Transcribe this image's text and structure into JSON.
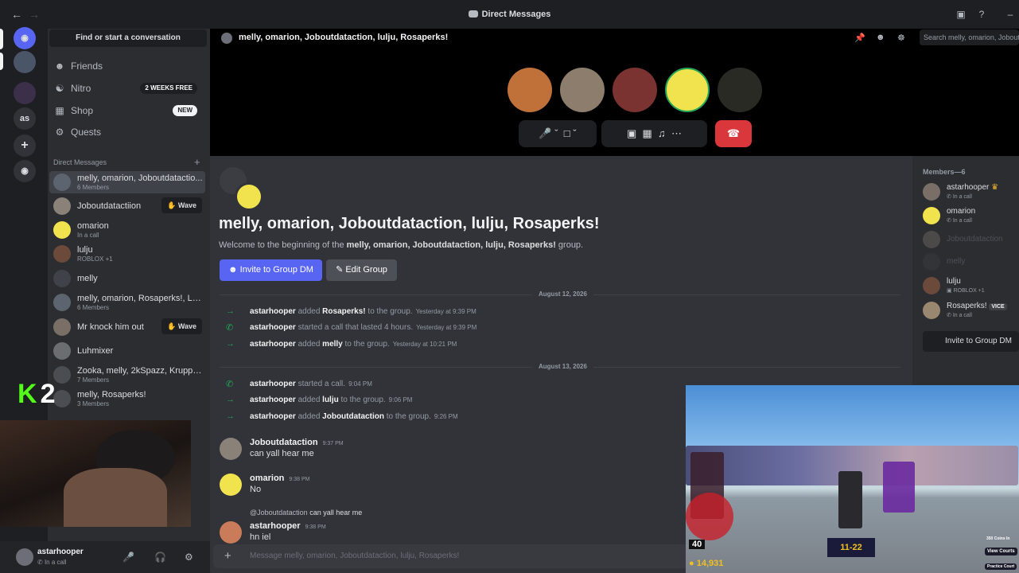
{
  "window": {
    "title": "Direct Messages"
  },
  "sidebar": {
    "search_label": "Find or start a conversation",
    "nav": [
      {
        "label": "Friends",
        "icon": "friends-icon"
      },
      {
        "label": "Nitro",
        "icon": "nitro-icon",
        "badge": "2 WEEKS FREE"
      },
      {
        "label": "Shop",
        "icon": "shop-icon",
        "badge": "NEW"
      },
      {
        "label": "Quests",
        "icon": "quests-icon"
      }
    ],
    "dm_header": "Direct Messages",
    "dms": [
      {
        "name": "melly, omarion, Joboutdatactio...",
        "sub": "6 Members"
      },
      {
        "name": "Joboutdatactiion",
        "sub": "",
        "action": "Wave"
      },
      {
        "name": "omarion",
        "sub": "In a call"
      },
      {
        "name": "lulju",
        "sub": "ROBLOX +1"
      },
      {
        "name": "melly",
        "sub": ""
      },
      {
        "name": "melly, omarion, Rosaperks!, Luh...",
        "sub": "6 Members"
      },
      {
        "name": "Mr knock him out",
        "sub": "",
        "action": "Wave"
      },
      {
        "name": "Luhmixer",
        "sub": ""
      },
      {
        "name": "Zooka, melly, 2kSpazz, Krupptel...",
        "sub": "7 Members"
      },
      {
        "name": "melly, Rosaperks!",
        "sub": "3 Members"
      }
    ]
  },
  "user": {
    "name": "astarhooper",
    "status": "In a call"
  },
  "stream_overlay": {
    "k": "K",
    "num": "2"
  },
  "channel": {
    "name": "melly, omarion, Joboutdataction, lulju, Rosaperks!",
    "search_placeholder": "Search melly, omarion, Jobout"
  },
  "intro": {
    "title": "melly, omarion, Joboutdataction, lulju, Rosaperks!",
    "welcome_prefix": "Welcome to the beginning of the ",
    "welcome_group": "melly, omarion, Joboutdataction, lulju, Rosaperks!",
    "welcome_suffix": " group.",
    "invite_button": "Invite to Group DM",
    "edit_button": "Edit Group"
  },
  "dividers": [
    "August 12, 2026",
    "August 13, 2026"
  ],
  "system_messages": [
    {
      "user": "astarhooper",
      "pre": "added",
      "target": "Rosaperks!",
      "post": "to the group.",
      "time": "Yesterday at 9:39 PM",
      "kind": "add"
    },
    {
      "user": "astarhooper",
      "pre": "started a call that lasted 4 hours.",
      "target": "",
      "post": "",
      "time": "Yesterday at 9:39 PM",
      "kind": "call"
    },
    {
      "user": "astarhooper",
      "pre": "added",
      "target": "melly",
      "post": "to the group.",
      "time": "Yesterday at 10:21 PM",
      "kind": "add"
    },
    {
      "user": "astarhooper",
      "pre": "started a call.",
      "target": "",
      "post": "",
      "time": "9:04 PM",
      "kind": "call"
    },
    {
      "user": "astarhooper",
      "pre": "added",
      "target": "lulju",
      "post": "to the group.",
      "time": "9:06 PM",
      "kind": "add"
    },
    {
      "user": "astarhooper",
      "pre": "added",
      "target": "Joboutdataction",
      "post": "to the group.",
      "time": "9:26 PM",
      "kind": "add"
    }
  ],
  "messages": [
    {
      "author": "Joboutdataction",
      "time": "9:37 PM",
      "text": "can yall hear me"
    },
    {
      "author": "omarion",
      "time": "9:38 PM",
      "text": "No"
    },
    {
      "author": "astarhooper",
      "time": "9:38 PM",
      "text": "hn iel",
      "reply_to": "@Joboutdataction",
      "reply_text": "can yall hear me"
    }
  ],
  "composer": {
    "placeholder": "Message melly, omarion, Joboutdataction, lulju, Rosaperks!"
  },
  "members": {
    "header": "Members—6",
    "list": [
      {
        "name": "astarhooper",
        "sub": "In a call",
        "crown": "♛"
      },
      {
        "name": "omarion",
        "sub": "In a call"
      },
      {
        "name": "Joboutdataction",
        "sub": "",
        "dim": true
      },
      {
        "name": "melly",
        "sub": "",
        "dim": true
      },
      {
        "name": "lulju",
        "sub": "ROBLOX +1"
      },
      {
        "name": "Rosaperks!",
        "sub": "In a call",
        "tag": "VICE"
      }
    ],
    "invite": "Invite to Group DM"
  },
  "game": {
    "level": "40",
    "coins": "14,931",
    "wave": "11-22",
    "view_courts": "View Courts",
    "practice": "Practice Court",
    "side_text": "350 Coins In"
  },
  "colors": {
    "blurple": "#5865f2",
    "green": "#23a55a",
    "red": "#da373c",
    "kick": "#53fc18"
  }
}
